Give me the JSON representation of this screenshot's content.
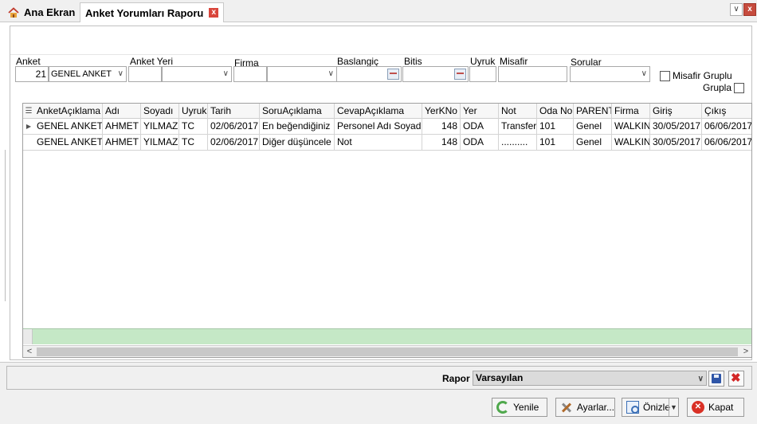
{
  "tabs": {
    "home_label": "Ana Ekran",
    "report_label": "Anket Yorumları Raporu",
    "close_glyph": "x"
  },
  "window": {
    "dropdown_glyph": "∨",
    "close_glyph": "x"
  },
  "filters": {
    "anket_label": "Anket",
    "anket_id": "21",
    "anket_name": "GENEL ANKET",
    "anket_yeri_label": "Anket Yeri",
    "firma_label": "Firma",
    "baslangic_label": "Baslangiç",
    "bitis_label": "Bitis",
    "uyruk_label": "Uyruk",
    "misafir_label": "Misafir",
    "sorular_label": "Sorular",
    "misafir_gruplu_label": "Misafir Gruplu",
    "grupla_label": "Grupla",
    "misafir_gruplu_checked": false,
    "grupla_checked": false
  },
  "grid": {
    "headers": [
      "AnketAçıklama",
      "Adı",
      "Soyadı",
      "Uyruk",
      "Tarih",
      "SoruAçıklama",
      "CevapAçıklama",
      "YerKNo",
      "Yer",
      "Not",
      "Oda No",
      "PARENT",
      "Firma",
      "Giriş",
      "Çıkış"
    ],
    "rows": [
      [
        "GENEL ANKET",
        "AHMET",
        "YILMAZ",
        "TC",
        "02/06/2017",
        "En beğendiğiniz",
        "Personel Adı Soyadı",
        "148",
        "ODA",
        "Transfer",
        "101",
        "Genel",
        "WALKIN",
        "30/05/2017",
        "06/06/2017"
      ],
      [
        "GENEL ANKET",
        "AHMET",
        "YILMAZ",
        "TC",
        "02/06/2017",
        "Diğer düşüncele",
        "Not",
        "148",
        "ODA",
        "..........",
        "101",
        "Genel",
        "WALKIN",
        "30/05/2017",
        "06/06/2017"
      ]
    ],
    "current_row_marker": "▶"
  },
  "report_bar": {
    "rapor_label": "Rapor",
    "rapor_value": "Varsayılan"
  },
  "buttons": {
    "refresh": "Yenile",
    "settings": "Ayarlar...",
    "preview": "Önizle",
    "close": "Kapat"
  },
  "colors": {
    "green_summary": "#c5e8c6",
    "tab_close": "#d9453b",
    "window_close": "#c64b3d"
  }
}
